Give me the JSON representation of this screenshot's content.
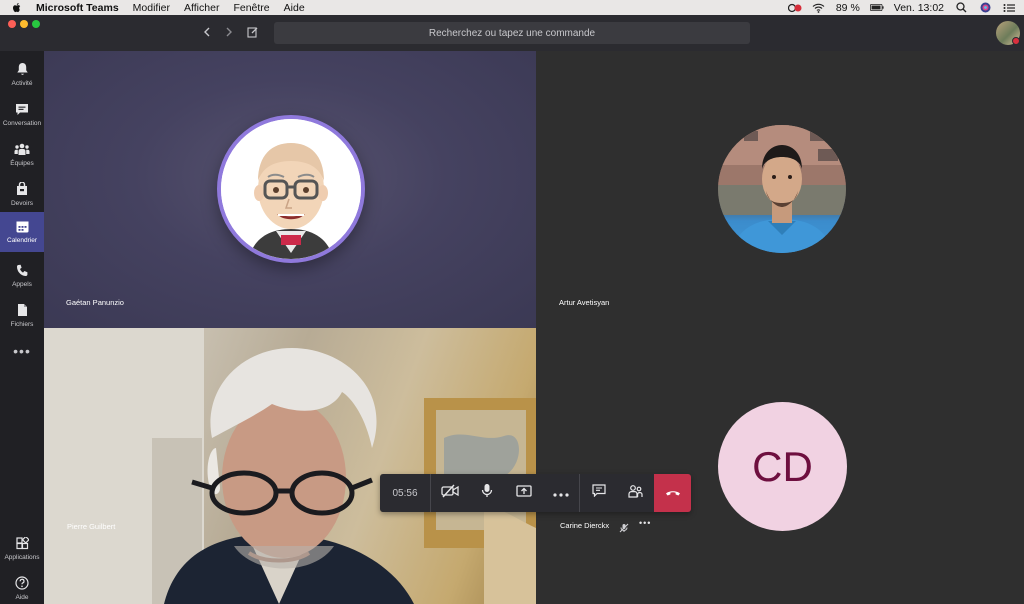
{
  "menubar": {
    "app_name": "Microsoft Teams",
    "menus": [
      "Modifier",
      "Afficher",
      "Fenêtre",
      "Aide"
    ],
    "battery": "89 %",
    "clock": "Ven. 13:02"
  },
  "titlebar": {
    "search_placeholder": "Recherchez ou tapez une commande"
  },
  "rail": {
    "items": [
      {
        "label": "Activité",
        "icon": "bell-icon"
      },
      {
        "label": "Conversation",
        "icon": "chat-icon"
      },
      {
        "label": "Équipes",
        "icon": "teams-icon"
      },
      {
        "label": "Devoirs",
        "icon": "assignments-icon"
      },
      {
        "label": "Calendrier",
        "icon": "calendar-icon",
        "active": true
      },
      {
        "label": "Appels",
        "icon": "phone-icon"
      },
      {
        "label": "Fichiers",
        "icon": "file-icon"
      }
    ],
    "more": "•••",
    "apps_label": "Applications",
    "help_label": "Aide"
  },
  "participants": [
    {
      "name": "Gaétan Panunzio",
      "type": "avatar-image"
    },
    {
      "name": "Artur Avetisyan",
      "type": "photo"
    },
    {
      "name": "Pierre Guilbert",
      "type": "video"
    },
    {
      "name": "Carine Dierckx",
      "type": "initials",
      "initials": "CD",
      "muted": true
    }
  ],
  "call": {
    "duration": "05:56"
  },
  "colors": {
    "accent": "#444791",
    "hangup": "#c4314b",
    "ring": "#8f79dc",
    "initials_bg": "#f1d2e2",
    "initials_text": "#6e0f3f"
  }
}
